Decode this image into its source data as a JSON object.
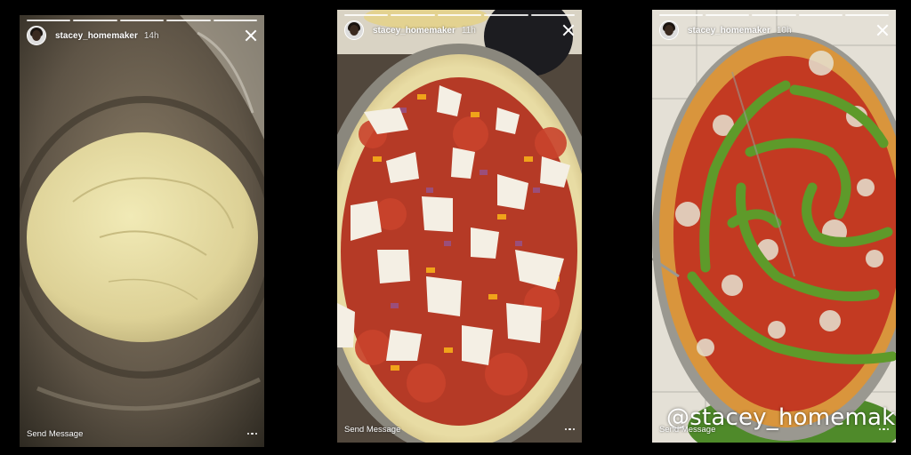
{
  "stories": [
    {
      "username": "stacey_homemaker",
      "time": "14h",
      "send_label": "Send Message",
      "photo": "bread-dough-in-bowl"
    },
    {
      "username": "stacey_homemaker",
      "time": "11h",
      "send_label": "Send Message",
      "photo": "uncooked-pizza"
    },
    {
      "username": "stacey_homemaker",
      "time": "10h",
      "send_label": "Send Message",
      "photo": "baked-pizza-with-pesto",
      "watermark": "@stacey_homemaker"
    }
  ],
  "icons": {
    "close": "close-icon",
    "more": "more-options-icon"
  },
  "colors": {
    "background": "#000000",
    "text": "#ffffff"
  }
}
